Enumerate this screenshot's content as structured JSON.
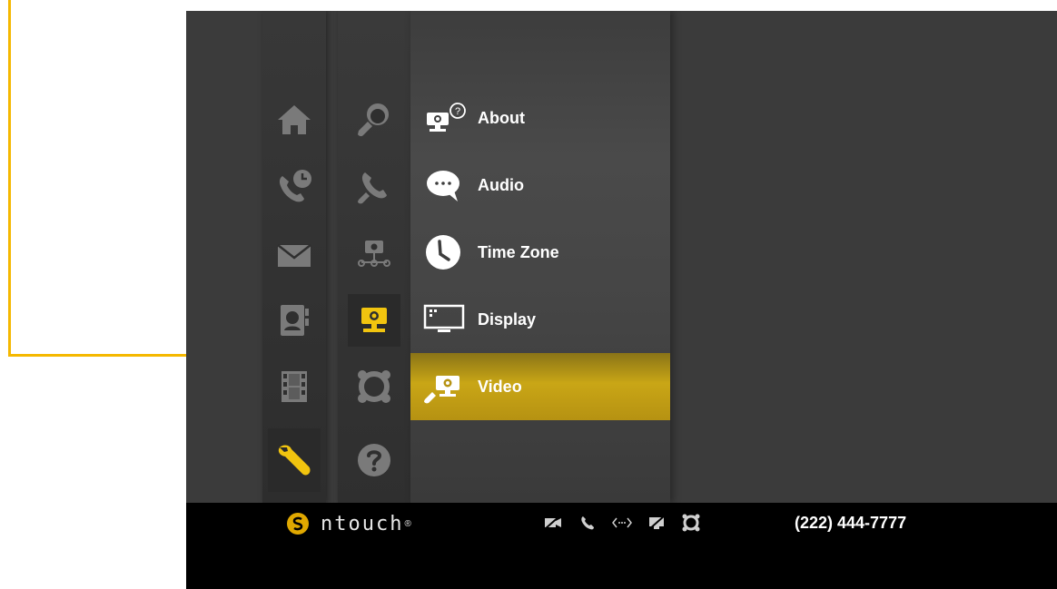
{
  "colors": {
    "accent": "#f5b800",
    "icon_gray": "#7a7a7a",
    "icon_active": "#f1c40f"
  },
  "nav_primary": [
    {
      "icon": "home-icon"
    },
    {
      "icon": "call-history-icon"
    },
    {
      "icon": "mail-icon"
    },
    {
      "icon": "contacts-icon"
    },
    {
      "icon": "video-center-icon"
    },
    {
      "icon": "wrench-icon",
      "selected": true
    }
  ],
  "nav_secondary": [
    {
      "icon": "personal-settings-icon"
    },
    {
      "icon": "call-settings-icon"
    },
    {
      "icon": "network-settings-icon"
    },
    {
      "icon": "device-settings-icon",
      "selected": true
    },
    {
      "icon": "ring-settings-icon"
    },
    {
      "icon": "help-icon"
    }
  ],
  "menu": {
    "items": [
      {
        "label": "About",
        "icon": "device-about-icon"
      },
      {
        "label": "Audio",
        "icon": "speech-bubble-icon"
      },
      {
        "label": "Time Zone",
        "icon": "clock-icon"
      },
      {
        "label": "Display",
        "icon": "monitor-icon"
      },
      {
        "label": "Video",
        "icon": "video-settings-icon",
        "active": true
      }
    ]
  },
  "bottom_bar": {
    "brand": "ntouch",
    "brand_mark": "®",
    "status_icons": [
      "video-off-icon",
      "phone-icon",
      "signal-icon",
      "privacy-off-icon",
      "ring-icon"
    ],
    "phone_number": "(222) 444-7777"
  }
}
